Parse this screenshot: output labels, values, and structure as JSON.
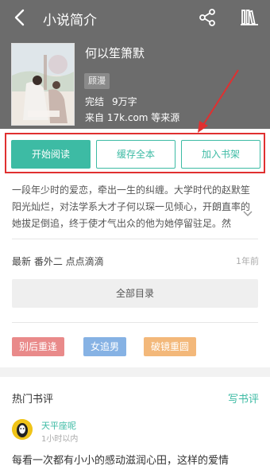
{
  "header": {
    "title": "小说简介",
    "back_icon": "back-arrow-icon",
    "share_icon": "share-icon",
    "bookshelf_icon": "bookshelf-icon"
  },
  "book": {
    "name": "何以笙箫默",
    "category": "顾漫",
    "status": "完结",
    "word_count": "9万字",
    "source": "来自 17k.com 等来源"
  },
  "actions": {
    "start_reading": "开始阅读",
    "cache_all": "缓存全本",
    "add_to_shelf": "加入书架"
  },
  "description": {
    "lines": [
      "一段年少时的爱恋，牵出一生的纠缠。大学时代的赵默笙",
      "阳光灿烂，对法学系大才子何以琛一见倾心，开朗直率的",
      "她拔足倒追，终于使才气出众的他为她停留驻足。然"
    ]
  },
  "latest": {
    "label": "最新 番外二 点点滴滴",
    "time": "1年前"
  },
  "catalog": {
    "label": "全部目录"
  },
  "tags": [
    {
      "label": "别后重逢",
      "color": "#e98a8a"
    },
    {
      "label": "女追男",
      "color": "#86b2e4"
    },
    {
      "label": "破镜重圆",
      "color": "#f3b87a"
    }
  ],
  "reviews": {
    "section_title": "热门书评",
    "write_label": "写书评",
    "items": [
      {
        "user": "天平座呢",
        "time": "1小时以内",
        "text": "每看一次都有小小的感动滋润心田，这样的爱情"
      }
    ]
  },
  "colors": {
    "accent": "#3dbba4",
    "header_bg": "#6c6c6c",
    "annotation_red": "#e03030"
  }
}
